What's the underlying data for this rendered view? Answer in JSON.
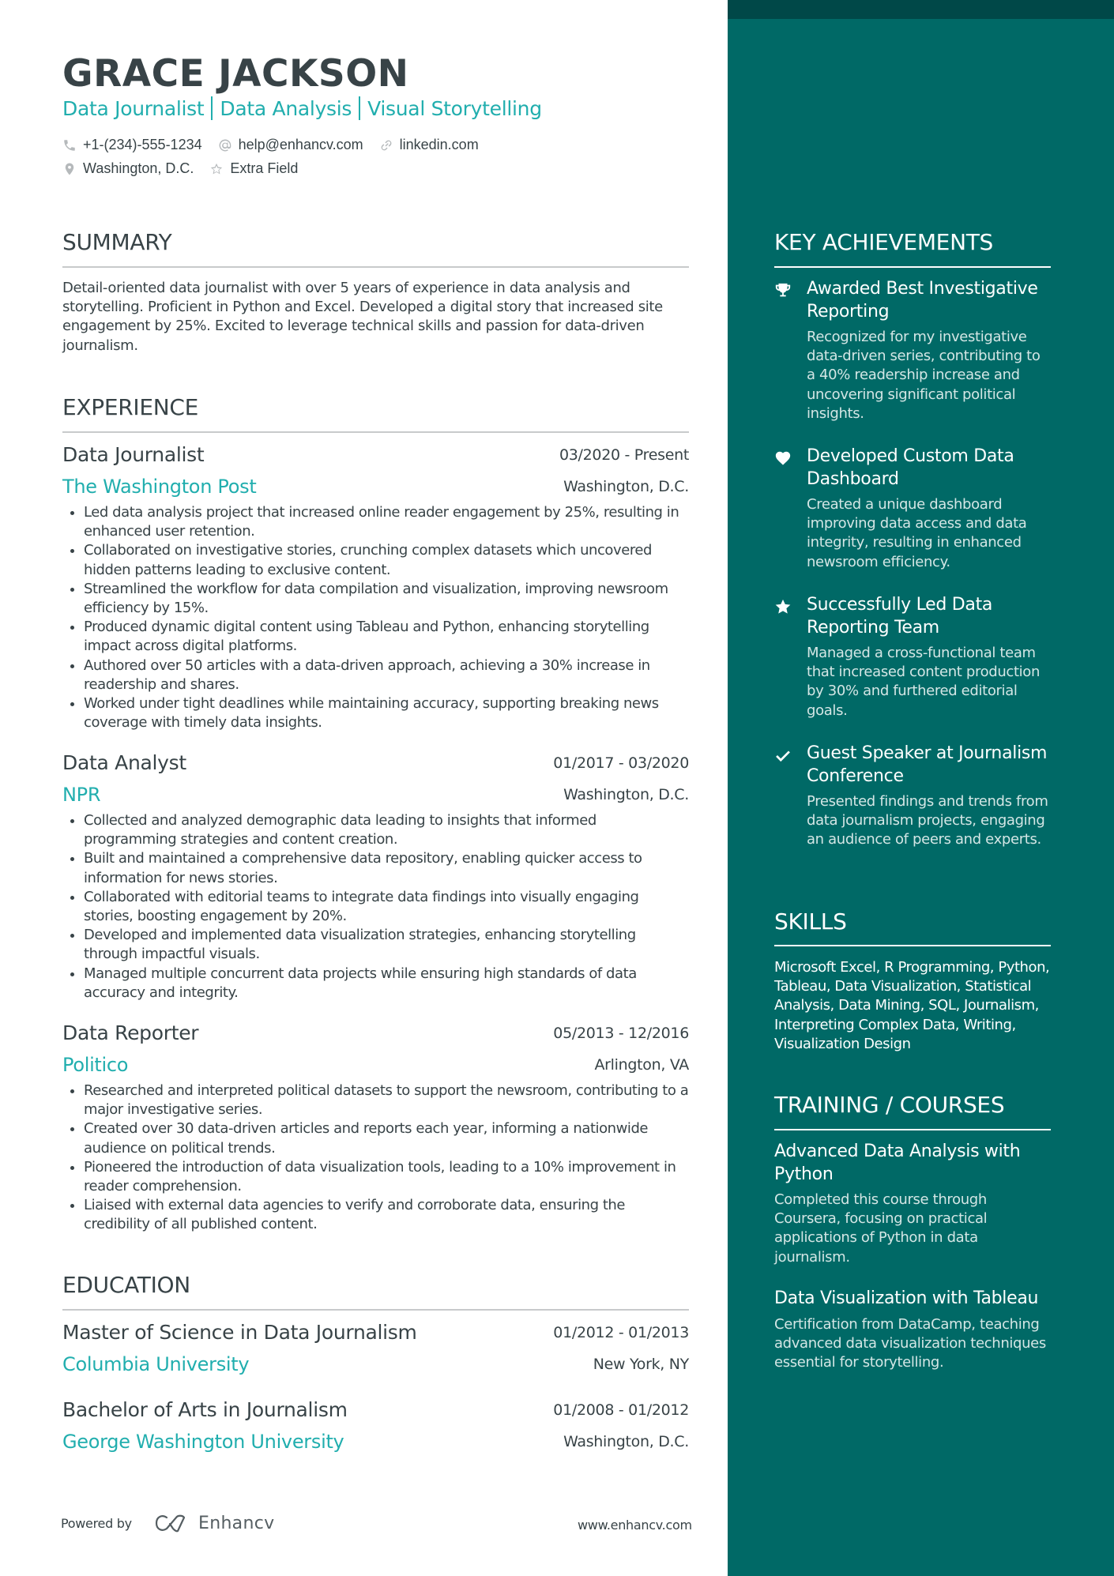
{
  "header": {
    "name": "GRACE JACKSON",
    "title_parts": [
      "Data Journalist",
      "Data Analysis",
      "Visual Storytelling"
    ],
    "contacts": {
      "phone": "+1-(234)-555-1234",
      "email": "help@enhancv.com",
      "linkedin": "linkedin.com",
      "location": "Washington, D.C.",
      "extra": "Extra Field"
    }
  },
  "summary": {
    "heading": "SUMMARY",
    "text": "Detail-oriented data journalist with over 5 years of experience in data analysis and storytelling. Proficient in Python and Excel. Developed a digital story that increased site engagement by 25%. Excited to leverage technical skills and passion for data-driven journalism."
  },
  "experience": {
    "heading": "EXPERIENCE",
    "jobs": [
      {
        "role": "Data Journalist",
        "dates": "03/2020 - Present",
        "company": "The Washington Post",
        "location": "Washington, D.C.",
        "bullets": [
          "Led data analysis project that increased online reader engagement by 25%, resulting in enhanced user retention.",
          "Collaborated on investigative stories, crunching complex datasets which uncovered hidden patterns leading to exclusive content.",
          "Streamlined the workflow for data compilation and visualization, improving newsroom efficiency by 15%.",
          "Produced dynamic digital content using Tableau and Python, enhancing storytelling impact across digital platforms.",
          "Authored over 50 articles with a data-driven approach, achieving a 30% increase in readership and shares.",
          "Worked under tight deadlines while maintaining accuracy, supporting breaking news coverage with timely data insights."
        ]
      },
      {
        "role": "Data Analyst",
        "dates": "01/2017 - 03/2020",
        "company": "NPR",
        "location": "Washington, D.C.",
        "bullets": [
          "Collected and analyzed demographic data leading to insights that informed programming strategies and content creation.",
          "Built and maintained a comprehensive data repository, enabling quicker access to information for news stories.",
          "Collaborated with editorial teams to integrate data findings into visually engaging stories, boosting engagement by 20%.",
          "Developed and implemented data visualization strategies, enhancing storytelling through impactful visuals.",
          "Managed multiple concurrent data projects while ensuring high standards of data accuracy and integrity."
        ]
      },
      {
        "role": "Data Reporter",
        "dates": "05/2013 - 12/2016",
        "company": "Politico",
        "location": "Arlington, VA",
        "bullets": [
          "Researched and interpreted political datasets to support the newsroom, contributing to a major investigative series.",
          "Created over 30 data-driven articles and reports each year, informing a nationwide audience on political trends.",
          "Pioneered the introduction of data visualization tools, leading to a 10% improvement in reader comprehension.",
          "Liaised with external data agencies to verify and corroborate data, ensuring the credibility of all published content."
        ]
      }
    ]
  },
  "education": {
    "heading": "EDUCATION",
    "items": [
      {
        "degree": "Master of Science in Data Journalism",
        "dates": "01/2012 - 01/2013",
        "school": "Columbia University",
        "location": "New York, NY"
      },
      {
        "degree": "Bachelor of Arts in Journalism",
        "dates": "01/2008 - 01/2012",
        "school": "George Washington University",
        "location": "Washington, D.C."
      }
    ]
  },
  "achievements": {
    "heading": "KEY ACHIEVEMENTS",
    "items": [
      {
        "icon": "trophy-icon",
        "title": "Awarded Best Investigative Reporting",
        "desc": "Recognized for my investigative data-driven series, contributing to a 40% readership increase and uncovering significant political insights."
      },
      {
        "icon": "heart-icon",
        "title": "Developed Custom Data Dashboard",
        "desc": "Created a unique dashboard improving data access and data integrity, resulting in enhanced newsroom efficiency."
      },
      {
        "icon": "star-icon",
        "title": "Successfully Led Data Reporting Team",
        "desc": "Managed a cross-functional team that increased content production by 30% and furthered editorial goals."
      },
      {
        "icon": "checkmark-icon",
        "title": "Guest Speaker at Journalism Conference",
        "desc": "Presented findings and trends from data journalism projects, engaging an audience of peers and experts."
      }
    ]
  },
  "skills": {
    "heading": "SKILLS",
    "text": "Microsoft Excel, R Programming, Python, Tableau, Data Visualization, Statistical Analysis, Data Mining, SQL, Journalism, Interpreting Complex Data, Writing, Visualization Design"
  },
  "training": {
    "heading": "TRAINING / COURSES",
    "items": [
      {
        "title": "Advanced Data Analysis with Python",
        "desc": "Completed this course through Coursera, focusing on practical applications of Python in data journalism."
      },
      {
        "title": "Data Visualization with Tableau",
        "desc": "Certification from DataCamp, teaching advanced data visualization techniques essential for storytelling."
      }
    ]
  },
  "footer": {
    "powered_by": "Powered by",
    "brand": "Enhancv",
    "url": "www.enhancv.com"
  },
  "colors": {
    "accent": "#21aeae",
    "sidebar": "#006966",
    "sidebar_band": "#004848",
    "text": "#384347"
  }
}
